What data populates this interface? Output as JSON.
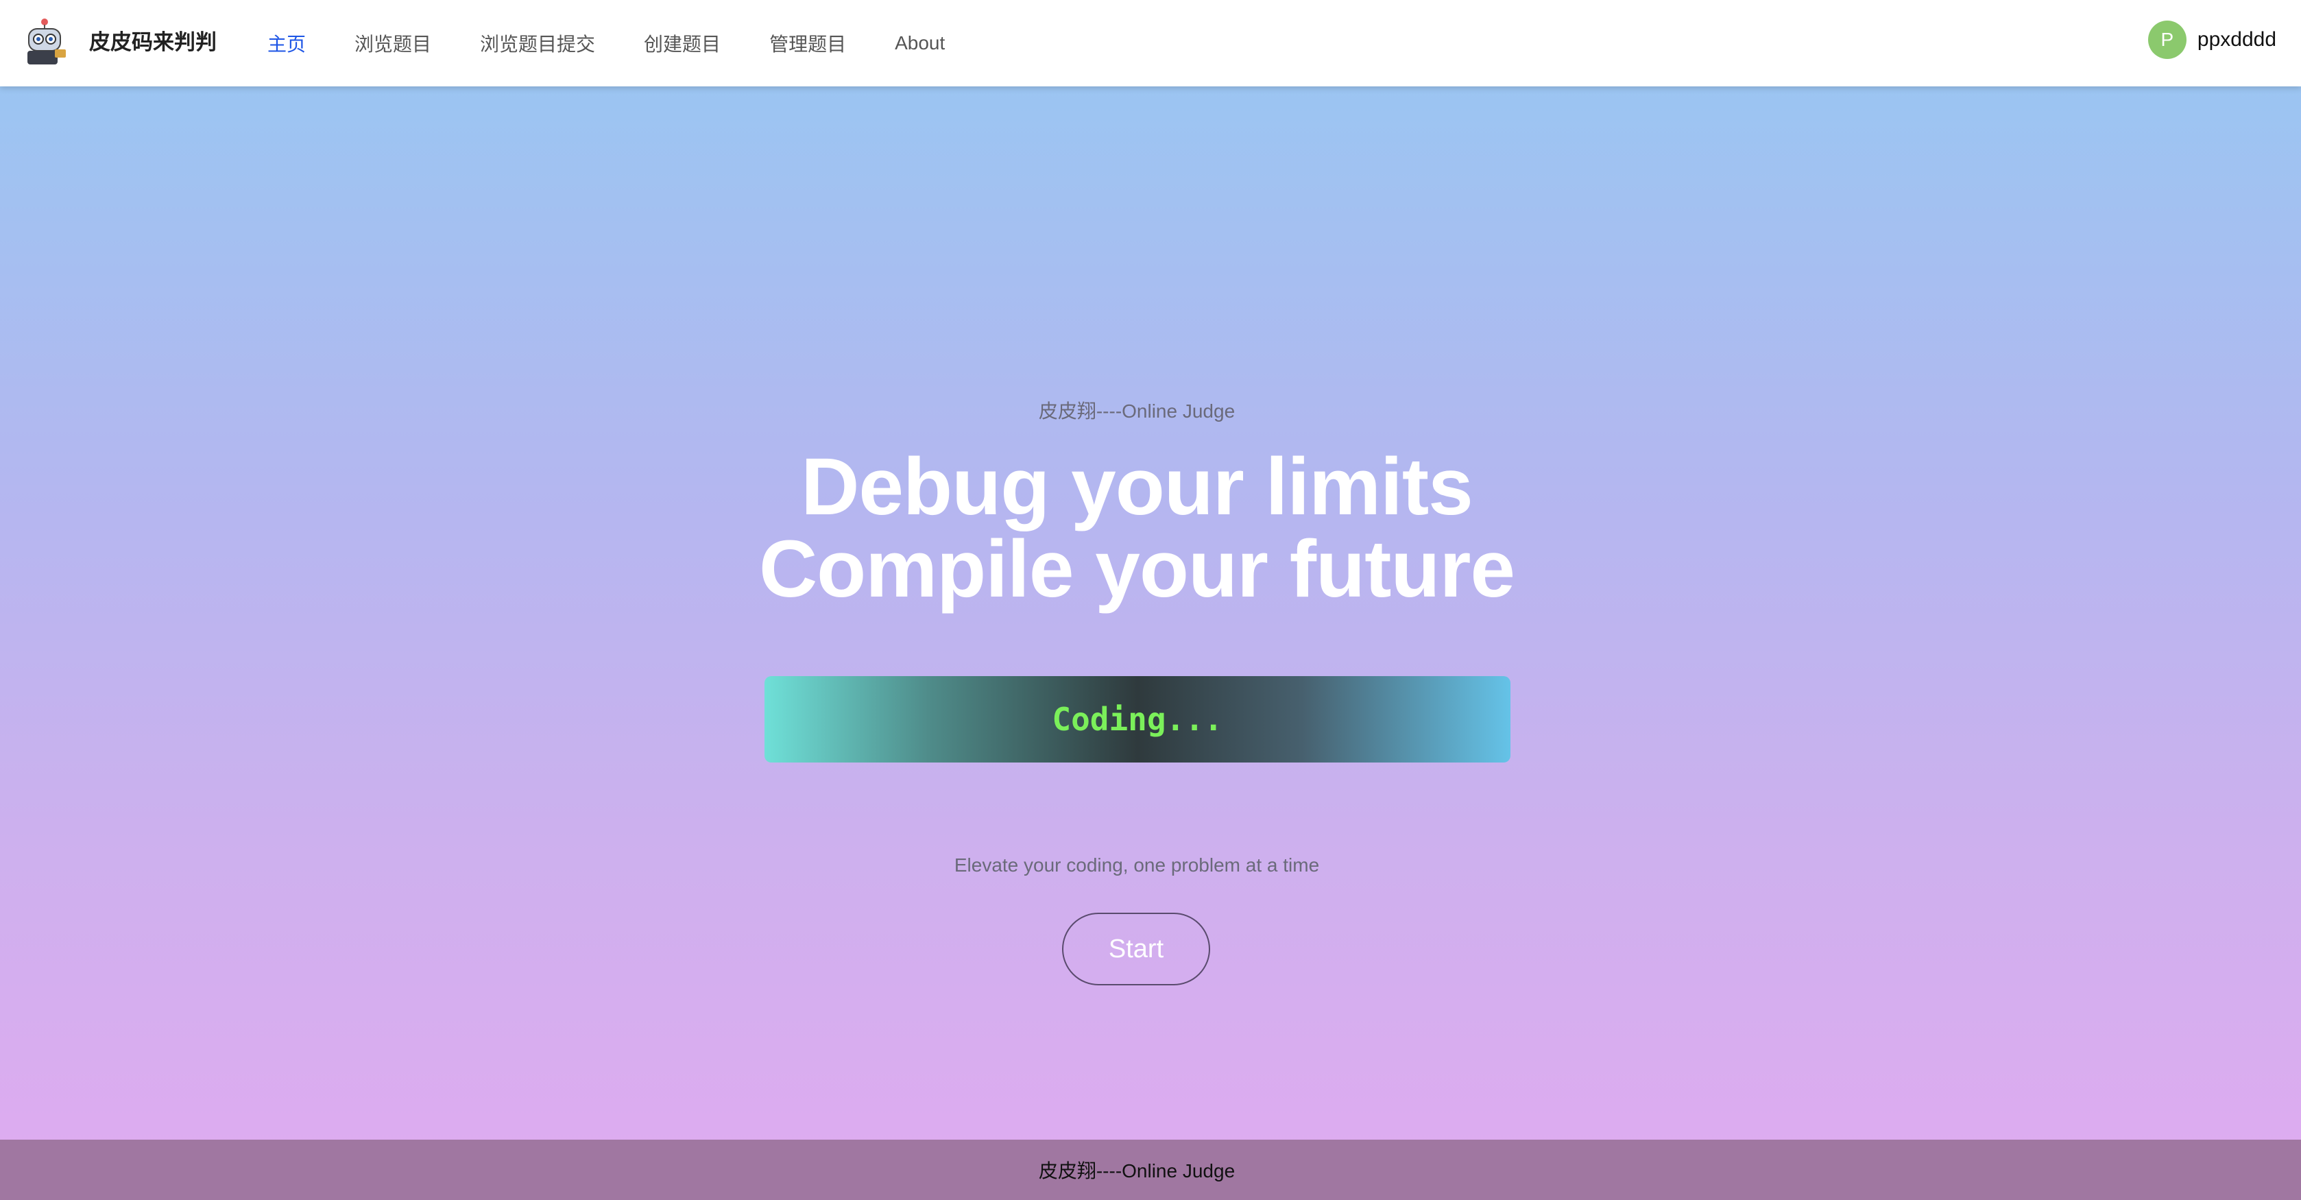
{
  "header": {
    "brand": "皮皮码来判判",
    "nav": [
      {
        "label": "主页",
        "active": true
      },
      {
        "label": "浏览题目",
        "active": false
      },
      {
        "label": "浏览题目提交",
        "active": false
      },
      {
        "label": "创建题目",
        "active": false
      },
      {
        "label": "管理题目",
        "active": false
      },
      {
        "label": "About",
        "active": false
      }
    ],
    "user": {
      "avatar_initial": "P",
      "name": "ppxdddd",
      "avatar_color": "#8bc96d"
    }
  },
  "hero": {
    "tagline": "皮皮翔----Online Judge",
    "headline_line1": "Debug your limits",
    "headline_line2": "Compile your future",
    "coding_text": "Coding...",
    "subtitle": "Elevate your coding, one problem at a time",
    "start_label": "Start"
  },
  "footer": {
    "text": "皮皮翔----Online Judge"
  },
  "colors": {
    "accent": "#1d55e6",
    "coding_text": "#7bf05a",
    "footer_bg": "#a077a1"
  },
  "icons": {
    "logo": "robot-mascot-icon"
  }
}
